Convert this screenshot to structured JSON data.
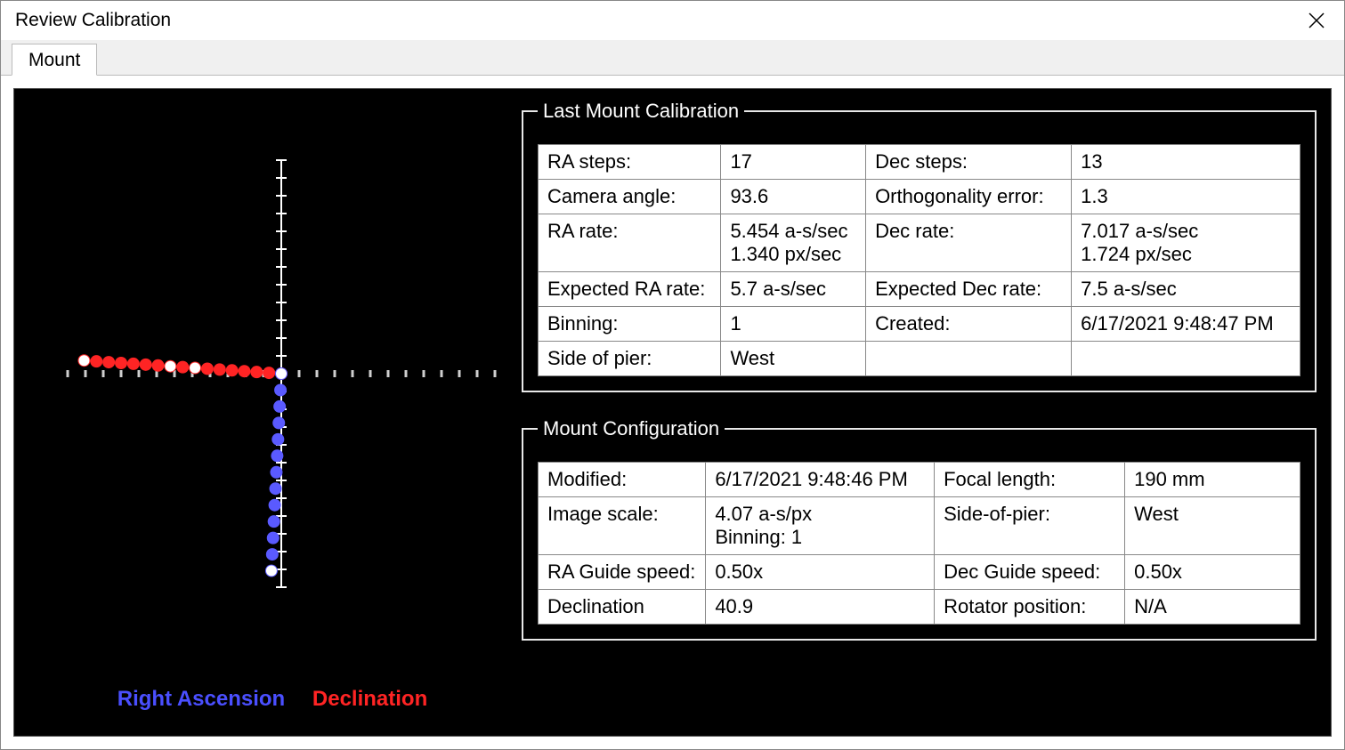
{
  "window": {
    "title": "Review Calibration"
  },
  "tabs": {
    "mount": "Mount"
  },
  "legend": {
    "ra": "Right Ascension",
    "dec": "Declination"
  },
  "groups": {
    "last_calibration": "Last Mount Calibration",
    "mount_config": "Mount Configuration"
  },
  "last_calibration": {
    "rows": [
      {
        "l1": "RA steps:",
        "v1": "17",
        "l2": "Dec steps:",
        "v2": "13"
      },
      {
        "l1": "Camera angle:",
        "v1": "93.6",
        "l2": "Orthogonality error:",
        "v2": "1.3"
      },
      {
        "l1": "RA rate:",
        "v1": "5.454 a-s/sec\n1.340 px/sec",
        "l2": "Dec rate:",
        "v2": "7.017 a-s/sec\n1.724 px/sec"
      },
      {
        "l1": "Expected RA rate:",
        "v1": "5.7 a-s/sec",
        "l2": "Expected Dec rate:",
        "v2": "7.5 a-s/sec"
      },
      {
        "l1": "Binning:",
        "v1": "1",
        "l2": "Created:",
        "v2": "6/17/2021 9:48:47 PM"
      },
      {
        "l1": "Side of pier:",
        "v1": "West",
        "l2": "",
        "v2": ""
      }
    ]
  },
  "mount_config": {
    "rows": [
      {
        "l1": "Modified:",
        "v1": "6/17/2021 9:48:46 PM",
        "l2": "Focal length:",
        "v2": "190 mm"
      },
      {
        "l1": "Image scale:",
        "v1": "4.07 a-s/px\nBinning: 1",
        "l2": "Side-of-pier:",
        "v2": "West"
      },
      {
        "l1": "RA Guide speed:",
        "v1": "0.50x",
        "l2": "Dec Guide speed:",
        "v2": "0.50x"
      },
      {
        "l1": "Declination",
        "v1": "40.9",
        "l2": "Rotator position:",
        "v2": "N/A"
      }
    ]
  },
  "chart_data": {
    "type": "scatter",
    "title": "",
    "xlabel": "",
    "ylabel": "",
    "xlim": [
      -260,
      260
    ],
    "ylim": [
      -260,
      260
    ],
    "series": [
      {
        "name": "Right Ascension",
        "color": "#ff2424",
        "points": [
          [
            0,
            0
          ],
          [
            -15,
            1
          ],
          [
            -30,
            2
          ],
          [
            -45,
            3
          ],
          [
            -60,
            4
          ],
          [
            -75,
            5
          ],
          [
            -90,
            6
          ],
          [
            -105,
            7
          ],
          [
            -120,
            8
          ],
          [
            -135,
            9
          ],
          [
            -150,
            10
          ],
          [
            -165,
            11
          ],
          [
            -180,
            12
          ],
          [
            -195,
            13
          ],
          [
            -210,
            14
          ],
          [
            -225,
            15
          ],
          [
            -240,
            16
          ]
        ]
      },
      {
        "name": "Declination",
        "color": "#5a5aff",
        "points": [
          [
            0,
            0
          ],
          [
            -1,
            -20
          ],
          [
            -2,
            -40
          ],
          [
            -3,
            -60
          ],
          [
            -4,
            -80
          ],
          [
            -5,
            -100
          ],
          [
            -6,
            -120
          ],
          [
            -7,
            -140
          ],
          [
            -8,
            -160
          ],
          [
            -9,
            -180
          ],
          [
            -10,
            -200
          ],
          [
            -11,
            -220
          ],
          [
            -12,
            -240
          ]
        ]
      }
    ],
    "highlight_points": [
      {
        "x": -240,
        "y": 16
      },
      {
        "x": -135,
        "y": 9
      },
      {
        "x": -105,
        "y": 7
      },
      {
        "x": 0,
        "y": 0
      },
      {
        "x": -12,
        "y": -240
      }
    ]
  }
}
